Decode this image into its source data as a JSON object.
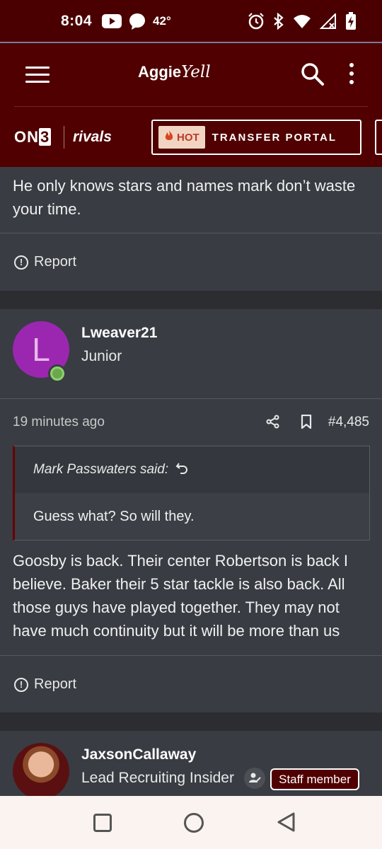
{
  "status_bar": {
    "time": "8:04",
    "temperature": "42°",
    "icons": [
      "youtube-icon",
      "messenger-icon",
      "alarm-icon",
      "bluetooth-icon",
      "wifi-icon",
      "signal-icon",
      "battery-charging-icon"
    ]
  },
  "header": {
    "logo_main": "Aggie",
    "logo_script": "Yell",
    "icons": [
      "menu-icon",
      "search-icon",
      "more-vert-icon"
    ]
  },
  "subheader": {
    "on3_text": "ON",
    "on3_digit": "3",
    "rivals_text": "rivals",
    "hot_label": "HOT",
    "portal_label": "TRANSFER PORTAL"
  },
  "posts": [
    {
      "body": "He only knows stars and names mark don’t waste your time.",
      "report_label": "Report"
    },
    {
      "avatar_letter": "L",
      "username": "Lweaver21",
      "user_title": "Junior",
      "time_ago": "19 minutes ago",
      "post_number": "#4,485",
      "quote_author": "Mark Passwaters said:",
      "quote_text": "Guess what? So will they.",
      "body": "Goosby is back. Their center Robertson is back I believe. Baker their 5 star tackle is also back. All those guys have played together. They may not have much continuity but it will be more than us",
      "report_label": "Report"
    },
    {
      "username": "JaxsonCallaway",
      "user_title": "Lead Recruiting Insider",
      "badge": "Staff member"
    }
  ],
  "colors": {
    "brand_maroon": "#500000",
    "card_bg": "#393c43",
    "page_bg": "#2b2d31",
    "online_green": "#6aa84f",
    "avatar_purple": "#9b27b0"
  },
  "nav_bar": {
    "icons": [
      "recents-square-icon",
      "home-circle-icon",
      "back-triangle-icon"
    ]
  }
}
